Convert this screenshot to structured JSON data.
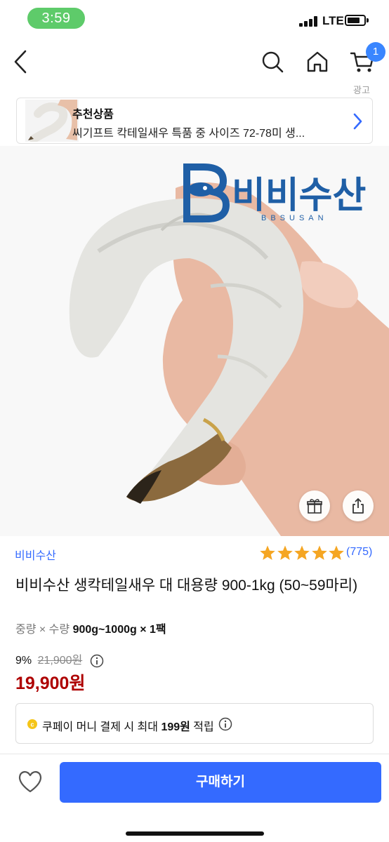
{
  "status_bar": {
    "time": "3:59",
    "network": "LTE"
  },
  "nav": {
    "icons": [
      "back-icon",
      "search-icon",
      "home-icon",
      "cart-icon"
    ],
    "cart_badge": "1",
    "ad_label": "광고"
  },
  "recommended": {
    "title": "추천상품",
    "description": "씨기프트 칵테일새우 특품 중 사이즈 72-78미 생..."
  },
  "product": {
    "brand_logo_text": "비비수산",
    "brand_logo_sub": "BBSUSAN",
    "seller": "비비수산",
    "rating": 5,
    "review_count": "(775)",
    "title": "비비수산 생칵테일새우 대 대용량 900-1kg (50~59마리)",
    "option_label": "중량 × 수량",
    "option_value": "900g~1000g × 1팩",
    "discount_rate": "9%",
    "original_price": "21,900원",
    "sale_price": "19,900원",
    "cashback_prefix": "쿠페이 머니 결제 시 최대 ",
    "cashback_amount": "199원",
    "cashback_suffix": " 적립"
  },
  "actions": {
    "buy_label": "구매하기"
  },
  "colors": {
    "accent": "#346aff",
    "price_red": "#ae0000",
    "star": "#f5a623",
    "status_green": "#5ecb6a",
    "badge": "#3a86ff"
  }
}
